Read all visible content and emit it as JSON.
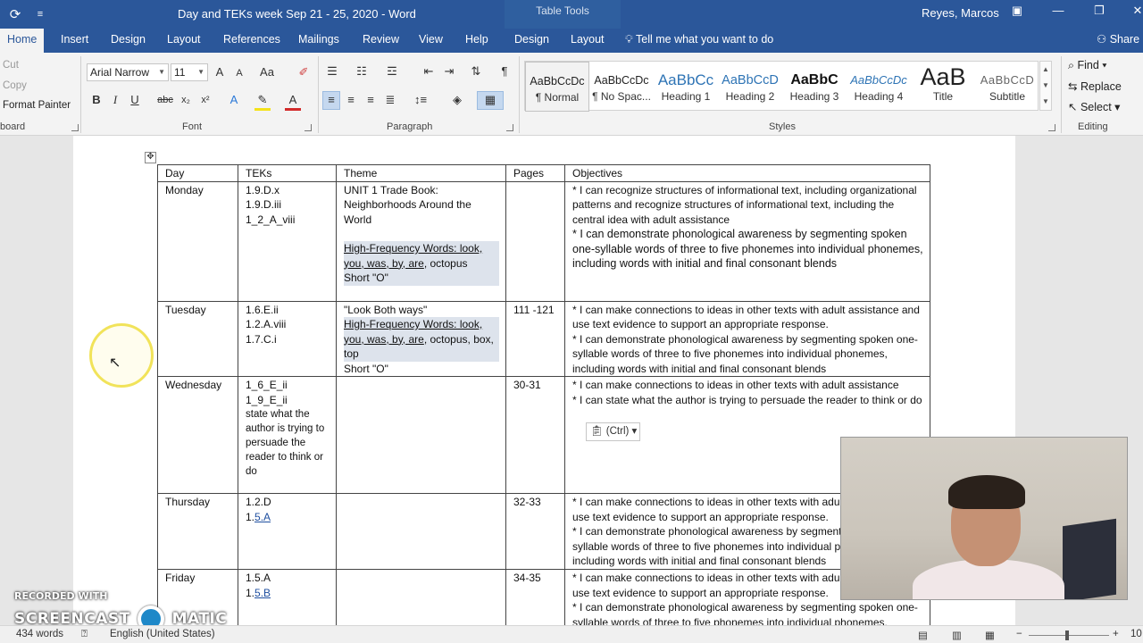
{
  "titlebar": {
    "document_title": "Day and TEKs week Sep 21 - 25, 2020  -  Word",
    "contextual_tab_group": "Table Tools",
    "user_name": "Reyes, Marcos"
  },
  "ribbon_tabs": {
    "home": "Home",
    "insert": "Insert",
    "design": "Design",
    "layout": "Layout",
    "references": "References",
    "mailings": "Mailings",
    "review": "Review",
    "view": "View",
    "help": "Help",
    "table_design": "Design",
    "table_layout": "Layout",
    "tell_me": "Tell me what you want to do",
    "share": "Share"
  },
  "clipboard": {
    "cut": "Cut",
    "copy": "Copy",
    "format_painter": "Format Painter",
    "label": "board"
  },
  "font": {
    "family": "Arial Narrow",
    "size": "11",
    "change_case": "Aa",
    "label": "Font",
    "bold": "B",
    "italic": "I",
    "underline": "U",
    "strikethrough": "abc",
    "subscript": "x₂",
    "superscript": "x²",
    "text_effects": "A",
    "font_color": "A",
    "grow": "A",
    "shrink": "A"
  },
  "paragraph": {
    "label": "Paragraph"
  },
  "styles": {
    "label": "Styles",
    "items": [
      {
        "preview": "AaBbCcDc",
        "name": "¶ Normal"
      },
      {
        "preview": "AaBbCcDc",
        "name": "¶ No Spac..."
      },
      {
        "preview": "AaBbCc",
        "name": "Heading 1"
      },
      {
        "preview": "AaBbCcD",
        "name": "Heading 2"
      },
      {
        "preview": "AaBbC",
        "name": "Heading 3"
      },
      {
        "preview": "AaBbCcDc",
        "name": "Heading 4"
      },
      {
        "preview": "AaB",
        "name": "Title"
      },
      {
        "preview": "AaBbCcD",
        "name": "Subtitle"
      }
    ]
  },
  "editing": {
    "find": "Find",
    "replace": "Replace",
    "select": "Select",
    "label": "Editing"
  },
  "table": {
    "headers": [
      "Day",
      "TEKs",
      "Theme",
      "Pages",
      "Objectives"
    ],
    "monday": {
      "day": "Monday",
      "teks": [
        "1.9.D.x",
        "1.9.D.iii",
        "1_2_A_viii"
      ],
      "theme_lines": [
        "UNIT 1 Trade Book:",
        "Neighborhoods Around the",
        "World"
      ],
      "hf_words_1": "High-Frequency Words: look,",
      "hf_words_2": "you, was, by, are",
      "hf_words_2_tail": ", octopus",
      "short_o": "Short \"O\"",
      "pages": "",
      "objective_1": "* I can recognize structures of informational text, including organizational patterns and recognize structures of informational text, including the central idea with adult assistance",
      "objective_2": "* I can demonstrate phonological awareness by segmenting spoken one-syllable words of three to five phonemes into individual phonemes, including words with initial and final consonant blends"
    },
    "tuesday": {
      "day": "Tuesday",
      "teks": [
        "1.6.E.ii",
        "1.2.A.viii",
        "1.7.C.i"
      ],
      "theme_title": "\"Look Both ways\"",
      "hf_words_1": "High-Frequency Words: look,",
      "hf_words_2": "you, was, by, are",
      "hf_words_2_tail": ", octopus, box,",
      "hf_words_3": "top",
      "short_o": "Short \"O\"",
      "pages": "111 -121",
      "objective_1": "* I can make connections to ideas in other texts with adult assistance and use text evidence to support an appropriate response.",
      "objective_2": "* I can demonstrate phonological awareness by segmenting spoken one-syllable words of three to five phonemes into individual phonemes, including words with initial and final consonant blends"
    },
    "wednesday": {
      "day": "Wednesday",
      "teks": [
        "1_6_E_ii",
        "1_9_E_ii"
      ],
      "teks_note": "state what the author is trying to persuade the reader to think or do",
      "pages": "30-31",
      "objective_1": "* I can make connections to ideas in other texts with adult assistance",
      "objective_2": "* I can  state what the author is trying to persuade the reader to think or do"
    },
    "thursday": {
      "day": "Thursday",
      "teks_1": "1.2.D",
      "teks_2_prefix": "1.",
      "teks_2_link": "5.A",
      "pages": "32-33",
      "objective_1": "* I can make connections to ideas in other texts with adult assistance and use text evidence to support an appropriate response.",
      "objective_2": "* I can demonstrate phonological awareness by segmenting spoken one-syllable words of three to five phonemes into individual phonemes, including words with initial and final consonant blends"
    },
    "friday": {
      "day": "Friday",
      "teks_1": "1.5.A",
      "teks_2_prefix": "1.",
      "teks_2_link": "5.B",
      "pages": "34-35",
      "objective_1": "* I can make connections to ideas in other texts with adult assistance and use text evidence to support an appropriate response.",
      "objective_2": "* I can demonstrate phonological awareness by segmenting spoken one-syllable words of three to five phonemes into individual phonemes,"
    }
  },
  "paste_options": "(Ctrl)",
  "watermark": {
    "line1": "RECORDED WITH",
    "line2_a": "SCREENCAST",
    "line2_b": "MATIC"
  },
  "statusbar": {
    "word_count": "434 words",
    "language": "English (United States)",
    "zoom": "10"
  },
  "colors": {
    "title_bar": "#2b579a",
    "highlight": "#dde3ec",
    "cursor_ring": "#f1e35a"
  }
}
